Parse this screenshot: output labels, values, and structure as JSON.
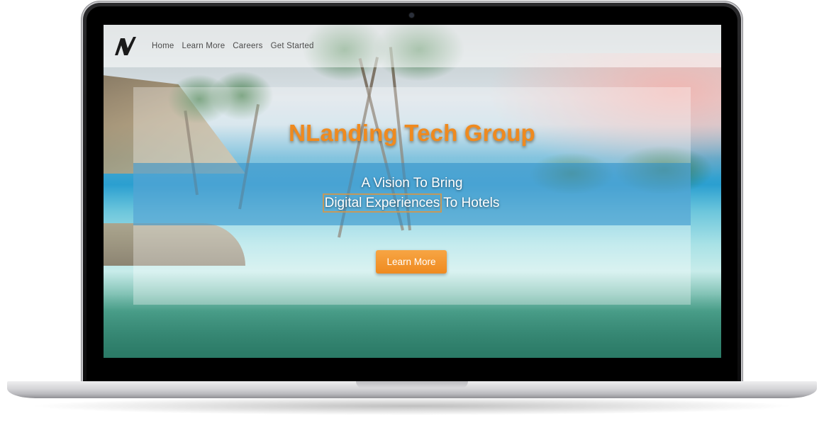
{
  "site": {
    "logo_letter": "N"
  },
  "nav": {
    "items": [
      {
        "label": "Home"
      },
      {
        "label": "Learn More"
      },
      {
        "label": "Careers"
      },
      {
        "label": "Get Started"
      }
    ]
  },
  "hero": {
    "title": "NLanding Tech Group",
    "tagline_line1": "A Vision To Bring",
    "tagline_line2_boxed": "Digital Experiences",
    "tagline_line2_rest": " To Hotels",
    "cta_label": "Learn More"
  },
  "colors": {
    "accent": "#ef8a1f",
    "tagline_band": "#288cc8",
    "nav_text": "#4b4b4b"
  },
  "icons": {
    "logo": "n-logo-icon",
    "camera": "camera-icon"
  }
}
